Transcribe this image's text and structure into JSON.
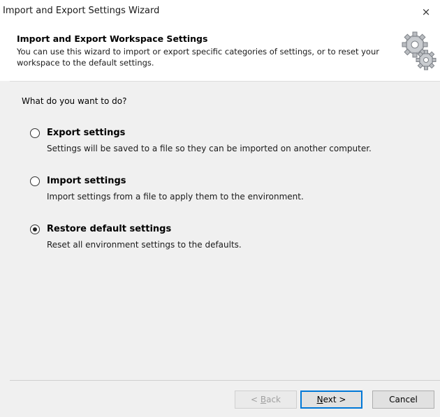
{
  "window": {
    "title": "Import and Export Settings Wizard",
    "close_glyph": "×"
  },
  "header": {
    "title": "Import and Export Workspace Settings",
    "description": "You can use this wizard to import or export specific categories of settings, or to reset your workspace to the default settings.",
    "icon": "gears-icon"
  },
  "main": {
    "question": "What do you want to do?",
    "options": [
      {
        "label": "Export settings",
        "description": "Settings will be saved to a file so they can be imported on another computer.",
        "selected": false
      },
      {
        "label": "Import settings",
        "description": "Import settings from a file to apply them to the environment.",
        "selected": false
      },
      {
        "label": "Restore default settings",
        "description": "Reset all environment settings to the defaults.",
        "selected": true
      }
    ]
  },
  "footer": {
    "back": {
      "prefix": "< ",
      "accel": "B",
      "rest": "ack",
      "enabled": false
    },
    "next": {
      "accel": "N",
      "rest": "ext >",
      "enabled": true
    },
    "cancel": {
      "label": "Cancel",
      "enabled": true
    }
  },
  "colors": {
    "focus_border": "#0078d7",
    "disabled_text": "#a0a0a0"
  }
}
